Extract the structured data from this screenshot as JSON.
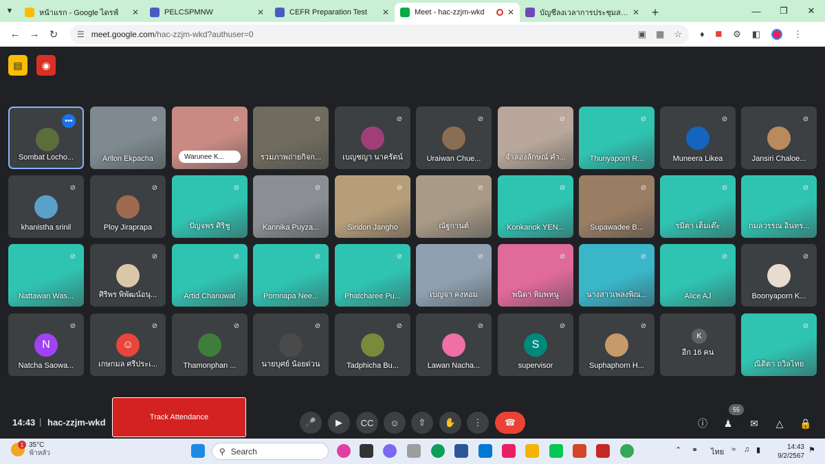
{
  "browser": {
    "tabs": [
      {
        "title": "หน้าแรก - Google ไดรฟ์",
        "color": "#fbbc04",
        "active": false
      },
      {
        "title": "PELCSPMNW",
        "color": "#4a5cc4",
        "active": false
      },
      {
        "title": "CEFR Preparation Test",
        "color": "#4a5cc4",
        "active": false
      },
      {
        "title": "Meet - hac-zzjm-wkd",
        "color": "#00ac47",
        "active": true
      },
      {
        "title": "บัญชีลงเวลาการประชุมสอบ CEFR ปี",
        "color": "#7248b9",
        "active": false
      }
    ],
    "url_host": "meet.google.com",
    "url_path": "/hac-zzjm-wkd?authuser=0"
  },
  "participants": [
    {
      "name": "Sombat Locho...",
      "kind": "photo",
      "color": "#5b6e3a",
      "speaking": true,
      "menu": true
    },
    {
      "name": "Arllon Ekpacha",
      "kind": "video",
      "color": "#7e8a8f"
    },
    {
      "name": "Warunee K...",
      "kind": "video",
      "color": "#c98a84",
      "pill": true
    },
    {
      "name": "รวมภาพถ่ายกิจก...",
      "kind": "video",
      "color": "#6f6b5e"
    },
    {
      "name": "เบญชญา นาครัตน์",
      "kind": "photo",
      "color": "#a13e7a"
    },
    {
      "name": "Uraiwan Chue...",
      "kind": "photo",
      "color": "#8a6d52"
    },
    {
      "name": "จำลองลักษณ์ คำ...",
      "kind": "video",
      "color": "#b8a79a"
    },
    {
      "name": "Thunyaporn R...",
      "kind": "video",
      "color": "#2fc4b2"
    },
    {
      "name": "Muneera Likea",
      "kind": "photo",
      "color": "#1565c0"
    },
    {
      "name": "Jansiri Chaloe...",
      "kind": "photo",
      "color": "#b98a5c"
    },
    {
      "name": "khanistha srinil",
      "kind": "photo",
      "color": "#5aa0c8"
    },
    {
      "name": "Ploy Jiraprapa",
      "kind": "photo",
      "color": "#a06a50"
    },
    {
      "name": "ปัญจพร ศิริชู",
      "kind": "video",
      "color": "#2fc4b2"
    },
    {
      "name": "Kannika Puyza...",
      "kind": "video",
      "color": "#8b8f93"
    },
    {
      "name": "Siridon Jangho",
      "kind": "video",
      "color": "#b79e7a"
    },
    {
      "name": "ณัฐกานต์",
      "kind": "video",
      "color": "#a89a86"
    },
    {
      "name": "Konkanok YEN...",
      "kind": "video",
      "color": "#2fc4b2"
    },
    {
      "name": "Supawadee B...",
      "kind": "video",
      "color": "#9a7e64"
    },
    {
      "name": "รมิตา เต็มเต๊ะ",
      "kind": "video",
      "color": "#2fc4b2"
    },
    {
      "name": "กมลวรรณ อินทร...",
      "kind": "video",
      "color": "#2fc4b2"
    },
    {
      "name": "Nattawan Was...",
      "kind": "video",
      "color": "#2fc4b2"
    },
    {
      "name": "ศิริพร พิพัฒน์อนุ...",
      "kind": "photo",
      "color": "#d9c7a8"
    },
    {
      "name": "Artid Chanuwat",
      "kind": "video",
      "color": "#2fc4b2"
    },
    {
      "name": "Pornnapa Nee...",
      "kind": "video",
      "color": "#2fc4b2"
    },
    {
      "name": "Phatcharee Pu...",
      "kind": "video",
      "color": "#2fc4b2"
    },
    {
      "name": "เบญจา คงหอม",
      "kind": "video",
      "color": "#8fa1b0"
    },
    {
      "name": "พนิดา พิมพหนู",
      "kind": "video",
      "color": "#e06a9a"
    },
    {
      "name": "นางสาวเพลงพิณ...",
      "kind": "video",
      "color": "#3ab6c9"
    },
    {
      "name": "Alice AJ",
      "kind": "video",
      "color": "#2fc4b2"
    },
    {
      "name": "Boonyaporn K...",
      "kind": "photo",
      "color": "#e8dcd0"
    },
    {
      "name": "Natcha Saowa...",
      "kind": "letter",
      "letter": "N",
      "color": "#a142f4"
    },
    {
      "name": "เกษกมล ศรีประเ...",
      "kind": "person",
      "color": "#e8453c"
    },
    {
      "name": "Thamonphan ...",
      "kind": "photo",
      "color": "#3f7d3a"
    },
    {
      "name": "นายบุศย์ น้อยด่วน",
      "kind": "photo",
      "color": "#4a4a4a"
    },
    {
      "name": "Tadphicha Bu...",
      "kind": "photo",
      "color": "#7a8a3a"
    },
    {
      "name": "Lawan Nacha...",
      "kind": "photo",
      "color": "#f06fa6"
    },
    {
      "name": "supervisor",
      "kind": "letter",
      "letter": "S",
      "color": "#00897b"
    },
    {
      "name": "Suphaphorn H...",
      "kind": "photo",
      "color": "#c79a6a"
    },
    {
      "name": "อีก 16 คน",
      "kind": "others",
      "letter": "K",
      "color": "#5f6368"
    },
    {
      "name": "ณิติตา ถวิลไทย",
      "kind": "video",
      "color": "#2fc4b2"
    }
  ],
  "meeting": {
    "time": "14:43",
    "separator": "|",
    "code": "hac-zzjm-wkd",
    "track_label": "Track Attendance",
    "participant_count": "55"
  },
  "taskbar": {
    "temperature": "35°C",
    "weather_desc": "ฟ้าหลัว",
    "weather_badge": "1",
    "search_placeholder": "Search",
    "language": "ไทย",
    "time": "14:43",
    "date": "9/2/2567"
  }
}
